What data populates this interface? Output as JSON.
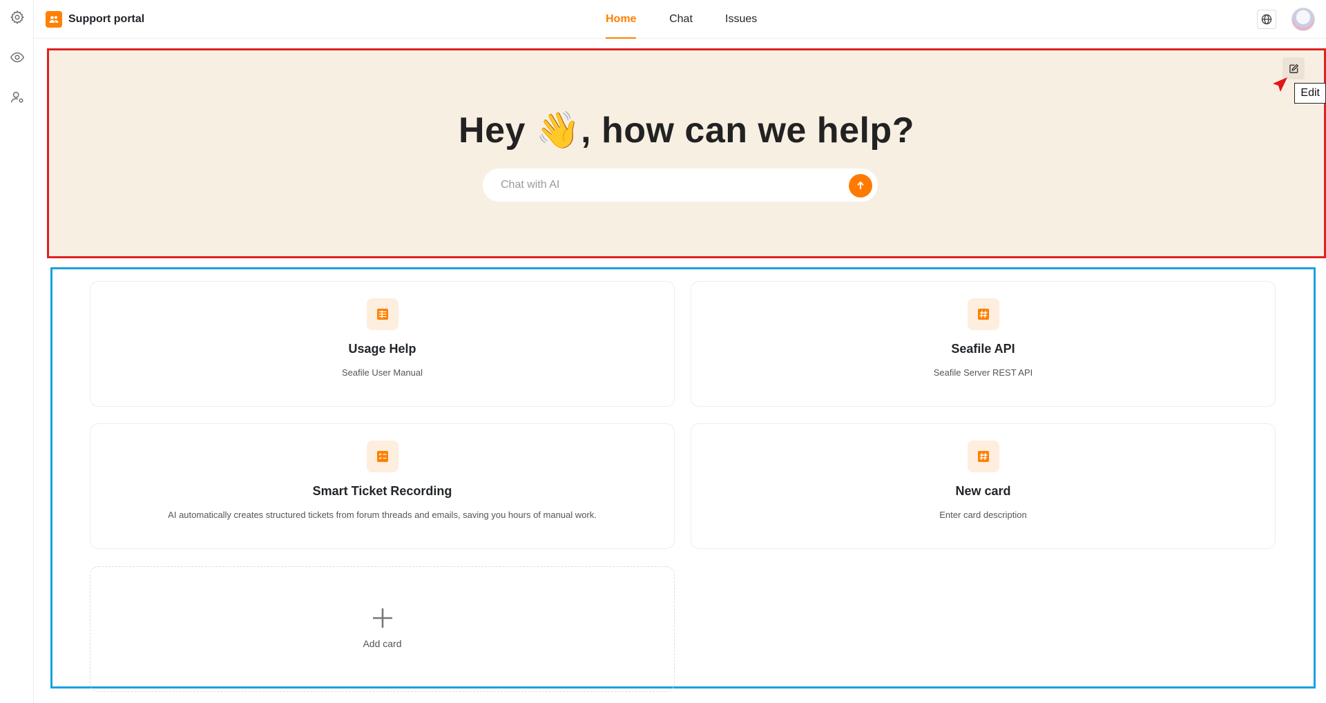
{
  "app": {
    "brand_name": "Support portal",
    "accent_color": "#ff8000"
  },
  "rail": {
    "items": [
      {
        "icon": "gear-icon"
      },
      {
        "icon": "eye-icon"
      },
      {
        "icon": "user-settings-icon"
      }
    ]
  },
  "nav": {
    "tabs": [
      {
        "label": "Home",
        "active": true
      },
      {
        "label": "Chat",
        "active": false
      },
      {
        "label": "Issues",
        "active": false
      }
    ]
  },
  "hero": {
    "title": "Hey 👋, how can we help?",
    "search_placeholder": "Chat with AI",
    "search_value": "",
    "edit_tooltip": "Edit",
    "background_color": "#f8efe3"
  },
  "cards": [
    {
      "title": "Usage Help",
      "description": "Seafile User Manual",
      "icon": "table-list-icon"
    },
    {
      "title": "Seafile API",
      "description": "Seafile Server REST API",
      "icon": "hashtag-icon"
    },
    {
      "title": "Smart Ticket Recording",
      "description": "AI automatically creates structured tickets from forum threads and emails, saving you hours of manual work.",
      "icon": "checklist-icon"
    },
    {
      "title": "New card",
      "description": "Enter card description",
      "icon": "hashtag-icon"
    }
  ],
  "add_card": {
    "label": "Add card"
  },
  "annotations": {
    "hero_outline_color": "#e02020",
    "cards_outline_color": "#1aa0e0"
  }
}
